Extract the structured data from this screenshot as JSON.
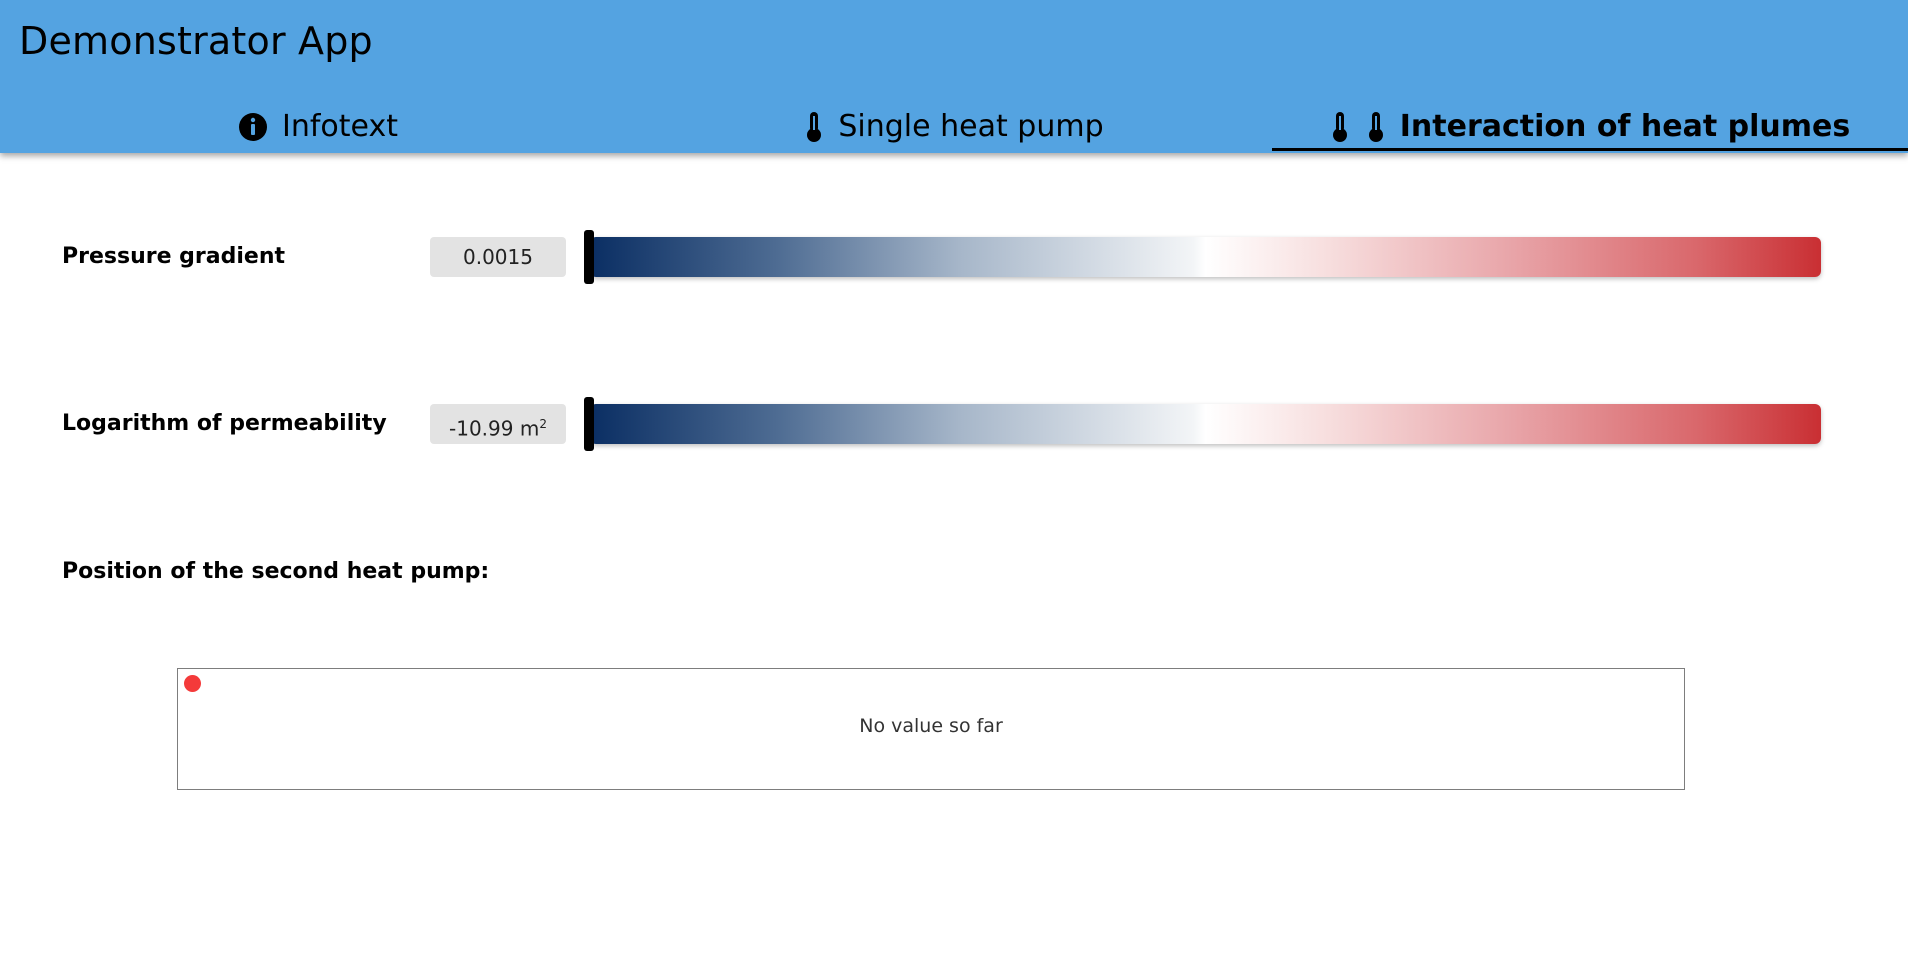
{
  "app": {
    "title": "Demonstrator App"
  },
  "tabs": [
    {
      "label": "Infotext",
      "icon": "info-circle-icon",
      "active": false
    },
    {
      "label": "Single heat pump",
      "icon": "thermometer-icon",
      "active": false
    },
    {
      "label": "Interaction of heat plumes",
      "icon": "two-thermometers-icon",
      "active": true
    }
  ],
  "params": {
    "pressure_gradient": {
      "label": "Pressure gradient",
      "value": "0.0015",
      "slider_position": 0.0
    },
    "permeability": {
      "label": "Logarithm of permeability",
      "value": "-10.99 m",
      "value_sup": "2",
      "slider_position": 0.0
    }
  },
  "position": {
    "title": "Position of the second heat pump:",
    "empty_text": "No value so far"
  },
  "colors": {
    "header": "#54a3e1",
    "gradient_start": "#0a2e63",
    "gradient_end": "#c92f33",
    "pump_dot": "#f43a3a",
    "value_box": "#e3e3e3"
  }
}
